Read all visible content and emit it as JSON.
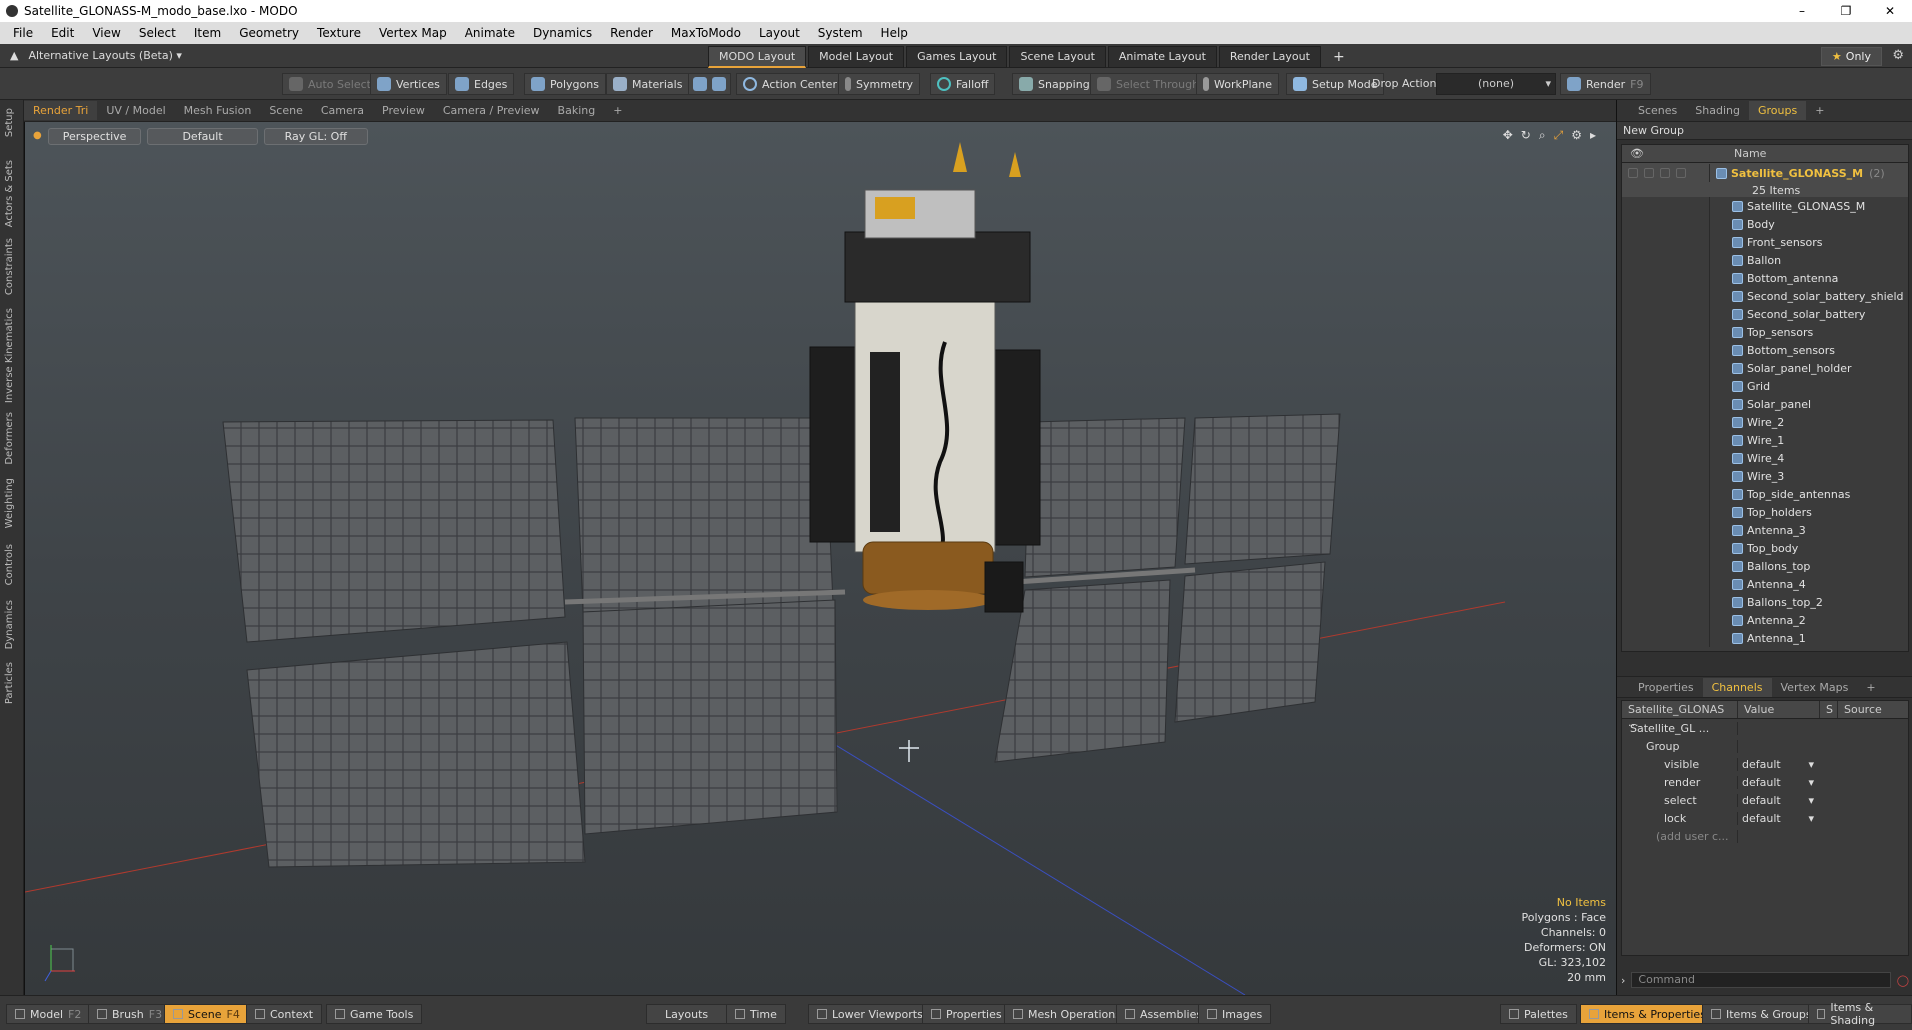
{
  "window": {
    "title": "Satellite_GLONASS-M_modo_base.lxo - MODO"
  },
  "menu": [
    "File",
    "Edit",
    "View",
    "Select",
    "Item",
    "Geometry",
    "Texture",
    "Vertex Map",
    "Animate",
    "Dynamics",
    "Render",
    "MaxToModo",
    "Layout",
    "System",
    "Help"
  ],
  "layouts": {
    "alt_label": "Alternative Layouts (Beta) ▾",
    "tabs": [
      "MODO Layout",
      "Model Layout",
      "Games Layout",
      "Scene Layout",
      "Animate Layout",
      "Render Layout"
    ],
    "add": "+",
    "only": "Only"
  },
  "toolbar": {
    "auto_select": "Auto Select",
    "vertices": "Vertices",
    "edges": "Edges",
    "polygons": "Polygons",
    "materials": "Materials",
    "action_center": "Action Center",
    "symmetry": "Symmetry",
    "falloff": "Falloff",
    "snapping": "Snapping",
    "select_through": "Select Through",
    "workplane": "WorkPlane",
    "setup_mode": "Setup Mode",
    "drop_action": "Drop Action",
    "drop_value": "(none)",
    "render": "Render",
    "render_key": "F9"
  },
  "left_strip": [
    "Setup",
    "Actors & Sets",
    "Constraints",
    "Inverse Kinematics",
    "Deformers",
    "Weighting",
    "Controls",
    "Dynamics",
    "Particles"
  ],
  "viewport_tabs": [
    "Render Tri",
    "UV / Model",
    "Mesh Fusion",
    "Scene",
    "Camera",
    "Preview",
    "Camera / Preview",
    "Baking",
    "+"
  ],
  "viewport": {
    "perspective": "Perspective",
    "shading": "Default",
    "raygl": "Ray GL: Off",
    "info": {
      "items": "No Items",
      "polygons": "Polygons : Face",
      "channels": "Channels: 0",
      "deformers": "Deformers: ON",
      "gl": "GL: 323,102",
      "scale": "20 mm"
    }
  },
  "groups_panel": {
    "tabs": [
      "Scenes",
      "Shading",
      "Groups",
      "+"
    ],
    "new_group": "New Group",
    "name_col": "Name",
    "group_name": "Satellite_GLONASS_M",
    "group_suffix": "(2)",
    "count": "25 Items",
    "items": [
      "Satellite_GLONASS_M",
      "Body",
      "Front_sensors",
      "Ballon",
      "Bottom_antenna",
      "Second_solar_battery_shield",
      "Second_solar_battery",
      "Top_sensors",
      "Bottom_sensors",
      "Solar_panel_holder",
      "Grid",
      "Solar_panel",
      "Wire_2",
      "Wire_1",
      "Wire_4",
      "Wire_3",
      "Top_side_antennas",
      "Top_holders",
      "Antenna_3",
      "Top_body",
      "Ballons_top",
      "Antenna_4",
      "Ballons_top_2",
      "Antenna_2",
      "Antenna_1"
    ]
  },
  "props_panel": {
    "tabs": [
      "Properties",
      "Channels",
      "Vertex Maps",
      "+"
    ],
    "cols": [
      "Satellite_GLONAS ...",
      "Value",
      "S",
      "Source"
    ],
    "tree_item": "Satellite_GL ...",
    "group": "Group",
    "channels": [
      {
        "name": "visible",
        "value": "default"
      },
      {
        "name": "render",
        "value": "default"
      },
      {
        "name": "select",
        "value": "default"
      },
      {
        "name": "lock",
        "value": "default"
      }
    ],
    "add_user": "(add user c...",
    "command_placeholder": "Command"
  },
  "bottom": {
    "model": "Model",
    "model_key": "F2",
    "brush": "Brush",
    "brush_key": "F3",
    "scene": "Scene",
    "scene_key": "F4",
    "context": "Context",
    "game_tools": "Game Tools",
    "layouts": "Layouts",
    "time": "Time",
    "lower_viewports": "Lower Viewports",
    "properties": "Properties",
    "mesh_operations": "Mesh Operations",
    "assemblies": "Assemblies",
    "images": "Images",
    "palettes": "Palettes",
    "items_properties": "Items & Properties",
    "items_groups": "Items & Groups",
    "items_shading": "Items & Shading"
  },
  "colors": {
    "accent": "#e8a33a",
    "viewport_top": "#4d5459",
    "grid_red": "#b03a2e",
    "grid_blue": "#3a4fc0"
  }
}
